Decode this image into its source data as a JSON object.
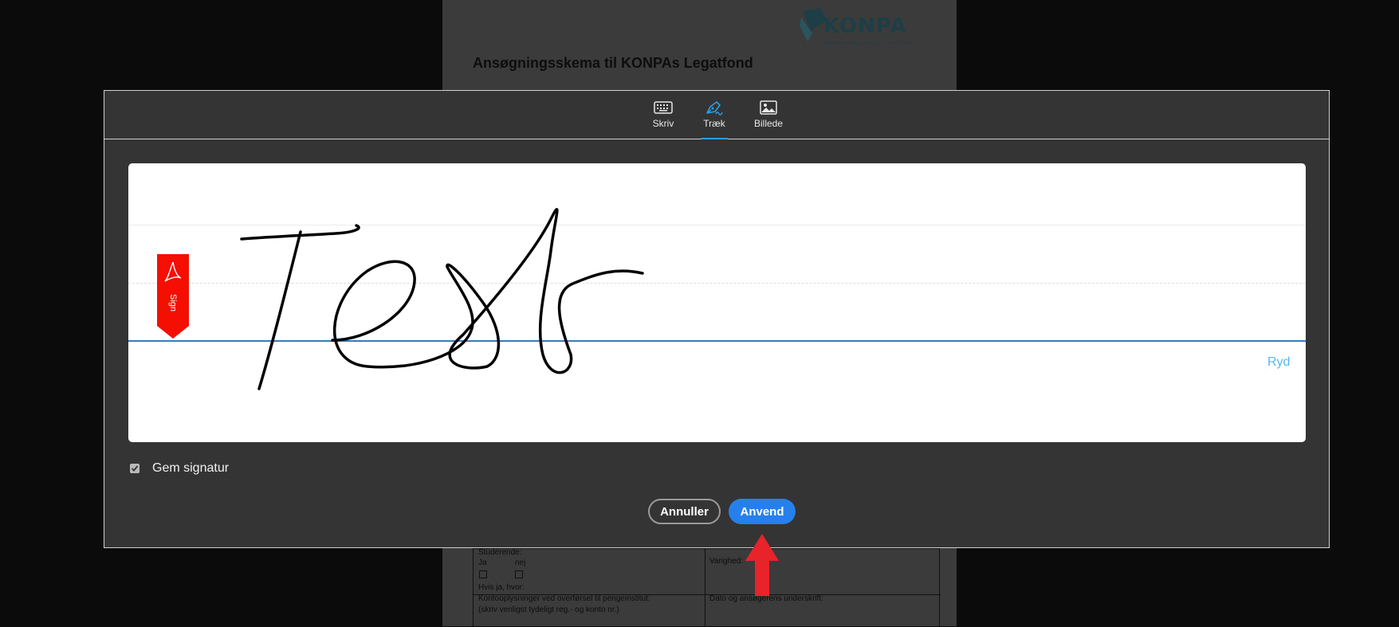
{
  "document": {
    "logo_word": "KONPA",
    "logo_tagline": "INSPIRERENDE FAGLIGT NETVÆRK",
    "title": "Ansøgningsskema til KONPAs Legatfond",
    "fields": {
      "student_label": "Studerende:",
      "yes_label": "Ja",
      "no_label": "nej",
      "if_yes_label": "Hvis ja, hvor:",
      "duration_label": "Varighed:",
      "account_label": "Kontooplysninger ved overførsel til pengeinstitut:",
      "account_hint": "(skriv venligst tydeligt reg.- og konto nr.)",
      "signature_label": "Dato og ansøgerens underskrift:"
    }
  },
  "dialog": {
    "tabs": [
      {
        "label": "Skriv",
        "icon": "keyboard-icon",
        "active": false
      },
      {
        "label": "Træk",
        "icon": "pen-icon",
        "active": true
      },
      {
        "label": "Billede",
        "icon": "image-icon",
        "active": false
      }
    ],
    "canvas": {
      "sign_flag_label": "Sign",
      "clear_label": "Ryd"
    },
    "save_signature": {
      "label": "Gem signatur",
      "checked": true
    },
    "buttons": {
      "cancel_label": "Annuller",
      "apply_label": "Anvend"
    }
  },
  "colors": {
    "accent": "#2680eb",
    "tab_active": "#2c9ee6",
    "baseline": "#2f7fc4",
    "sign_flag": "#f40f02",
    "arrow": "#e8232a"
  }
}
